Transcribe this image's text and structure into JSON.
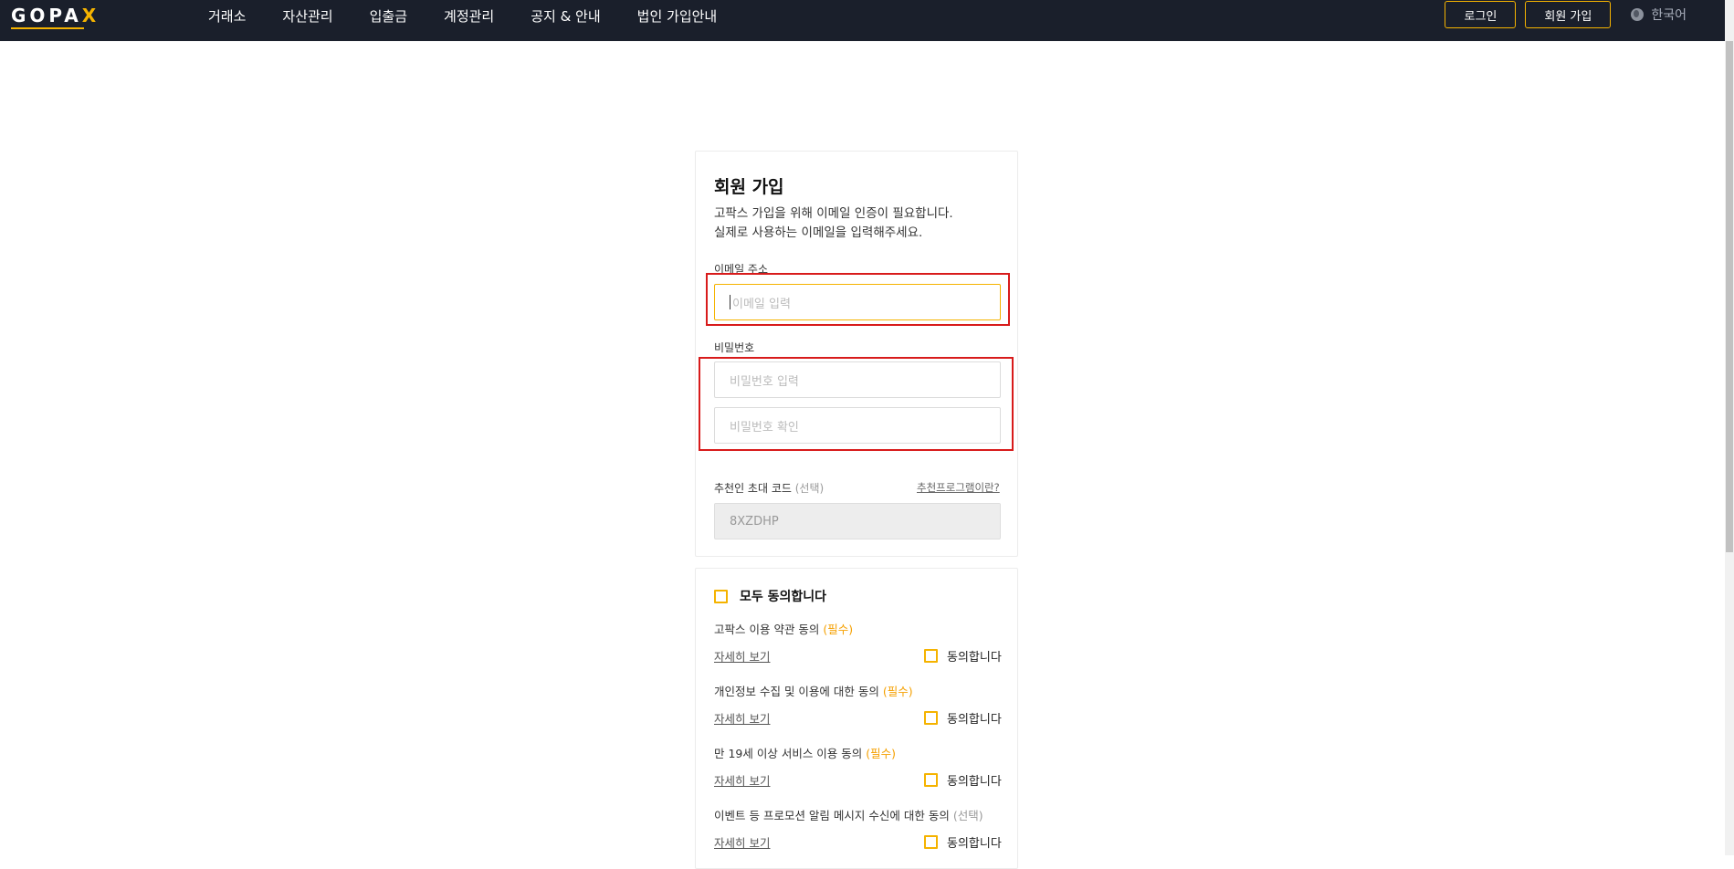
{
  "header": {
    "logo": "GOPAX",
    "nav": [
      "거래소",
      "자산관리",
      "입출금",
      "계정관리",
      "공지 & 안내",
      "법인 가입안내"
    ],
    "login_label": "로그인",
    "signup_label": "회원 가입",
    "language": "한국어"
  },
  "form": {
    "title": "회원 가입",
    "desc_line1": "고팍스 가입을 위해 이메일 인증이 필요합니다.",
    "desc_line2": "실제로 사용하는 이메일을 입력해주세요.",
    "email_label": "이메일 주소",
    "email_placeholder": "이메일 입력",
    "password_label": "비밀번호",
    "password_placeholder": "비밀번호 입력",
    "password_confirm_placeholder": "비밀번호 확인",
    "referral_label": "추천인 초대 코드",
    "referral_optional": "(선택)",
    "referral_link": "추천프로그램이란?",
    "referral_code": "8XZDHP"
  },
  "agreements": {
    "agree_all": "모두 동의합니다",
    "detail_label": "자세히 보기",
    "agree_label": "동의합니다",
    "required_tag": "(필수)",
    "optional_tag": "(선택)",
    "items": [
      {
        "title": "고팍스 이용 약관 동의",
        "tag": "(필수)"
      },
      {
        "title": "개인정보 수집 및 이용에 대한 동의",
        "tag": "(필수)"
      },
      {
        "title": "만 19세 이상 서비스 이용 동의",
        "tag": "(필수)"
      },
      {
        "title": "이벤트 등 프로모션 알림 메시지 수신에 대한 동의",
        "tag": "(선택)"
      }
    ]
  },
  "colors": {
    "header_bg": "#1a1f2b",
    "accent": "#f5b300",
    "highlight": "#d81b1b"
  }
}
